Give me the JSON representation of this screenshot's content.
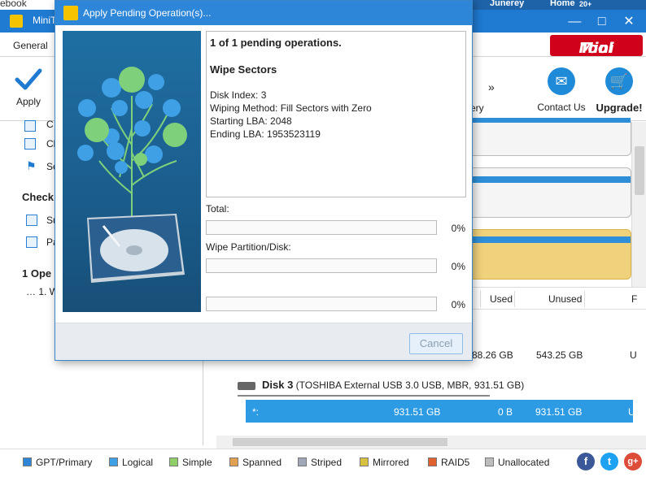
{
  "background": {
    "edge_fragment": "ebook",
    "taskbar": {
      "item1": "Junerey",
      "item2": "Home",
      "item3": "20+"
    },
    "app_title": "MiniT",
    "menu": {
      "general": "General"
    },
    "logo": {
      "mini": "Mini",
      "tool": "Tool"
    },
    "toolbar": {
      "apply": "Apply",
      "more": "»",
      "fragment": "ery",
      "contact": "Contact Us",
      "upgrade": "Upgrade!"
    },
    "left_panel": {
      "item1": "C",
      "item2": "Cl",
      "item3": "Se",
      "check_header": "Check",
      "item4": "Su",
      "item5": "Pa",
      "ops_header": "1 Ope",
      "op1": "1. W"
    },
    "table": {
      "col_used": "Used",
      "col_unused": "Unused",
      "col_f": "F",
      "row1_used": "88.26 GB",
      "row1_unused": "543.25 GB",
      "row1_end": "U",
      "disk_name": "Disk 3",
      "disk_desc": "(TOSHIBA External USB 3.0 USB, MBR, 931.51 GB)",
      "sel_name": "*:",
      "sel_capacity": "931.51 GB",
      "sel_used": "0 B",
      "sel_unused": "931.51 GB",
      "sel_end": "U"
    },
    "legend": [
      {
        "label": "GPT/Primary",
        "color": "#2d86d8"
      },
      {
        "label": "Logical",
        "color": "#3fa0e6"
      },
      {
        "label": "Simple",
        "color": "#8fcf6a"
      },
      {
        "label": "Spanned",
        "color": "#e0a050"
      },
      {
        "label": "Striped",
        "color": "#a0a8b8"
      },
      {
        "label": "Mirrored",
        "color": "#d8c040"
      },
      {
        "label": "RAID5",
        "color": "#e06030"
      },
      {
        "label": "Unallocated",
        "color": "#bdbdbd"
      }
    ],
    "social": {
      "facebook": "f",
      "twitter": "t",
      "google": "g+"
    }
  },
  "dialog": {
    "title": "Apply Pending Operation(s)...",
    "summary": "1 of 1 pending operations.",
    "operation": "Wipe Sectors",
    "details": {
      "disk_index": "Disk Index: 3",
      "method": "Wiping Method: Fill Sectors with Zero",
      "start": "Starting LBA: 2048",
      "end": "Ending LBA: 1953523119"
    },
    "progress": {
      "total_label": "Total:",
      "total_pct": "0%",
      "total_value": 0,
      "wipe_label": "Wipe Partition/Disk:",
      "wipe_pct": "0%",
      "wipe_value": 0,
      "third_pct": "0%",
      "third_value": 0
    },
    "cancel": "Cancel"
  }
}
